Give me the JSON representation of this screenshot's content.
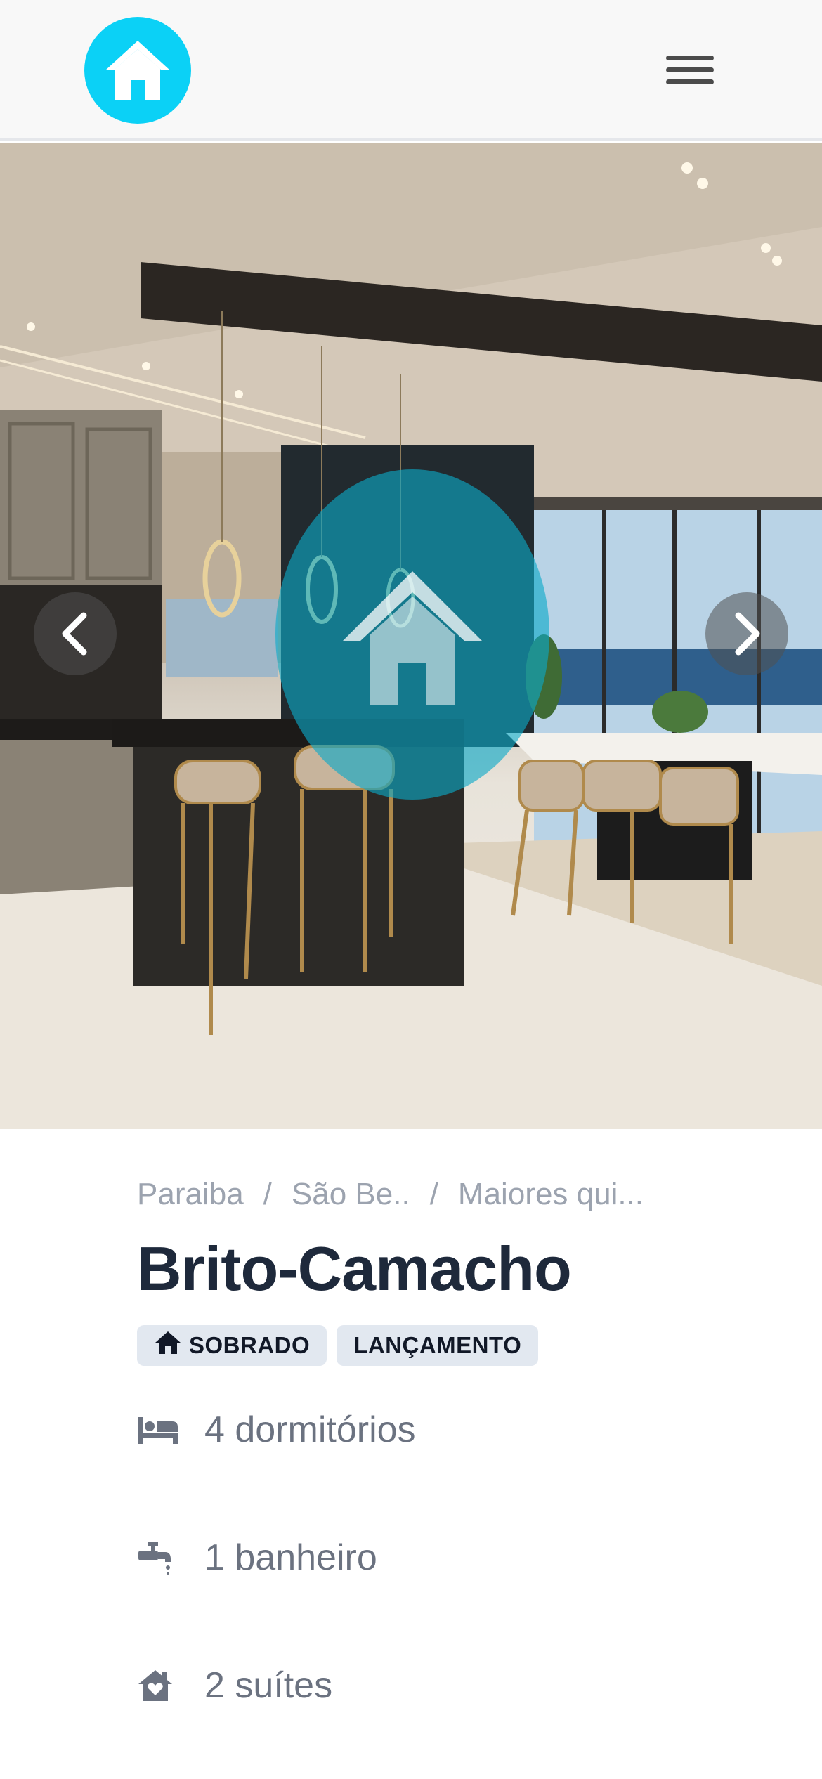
{
  "header": {
    "logo_icon": "house-logo-icon",
    "menu_icon": "hamburger-menu-icon",
    "brand_color": "#0bd1f6"
  },
  "gallery": {
    "prev_icon": "chevron-left-icon",
    "next_icon": "chevron-right-icon",
    "watermark_icon": "house-watermark-icon"
  },
  "breadcrumb": {
    "items": [
      "Paraiba",
      "São Be..",
      "Maiores qui..."
    ],
    "separator": "/"
  },
  "property": {
    "title": "Brito-Camacho",
    "badges": [
      {
        "label": "SOBRADO",
        "icon": "house-icon"
      },
      {
        "label": "LANÇAMENTO"
      }
    ],
    "features": [
      {
        "icon": "bed-icon",
        "text": "4 dormitórios"
      },
      {
        "icon": "faucet-icon",
        "text": "1 banheiro"
      },
      {
        "icon": "house-heart-icon",
        "text": "2 suítes"
      }
    ]
  }
}
